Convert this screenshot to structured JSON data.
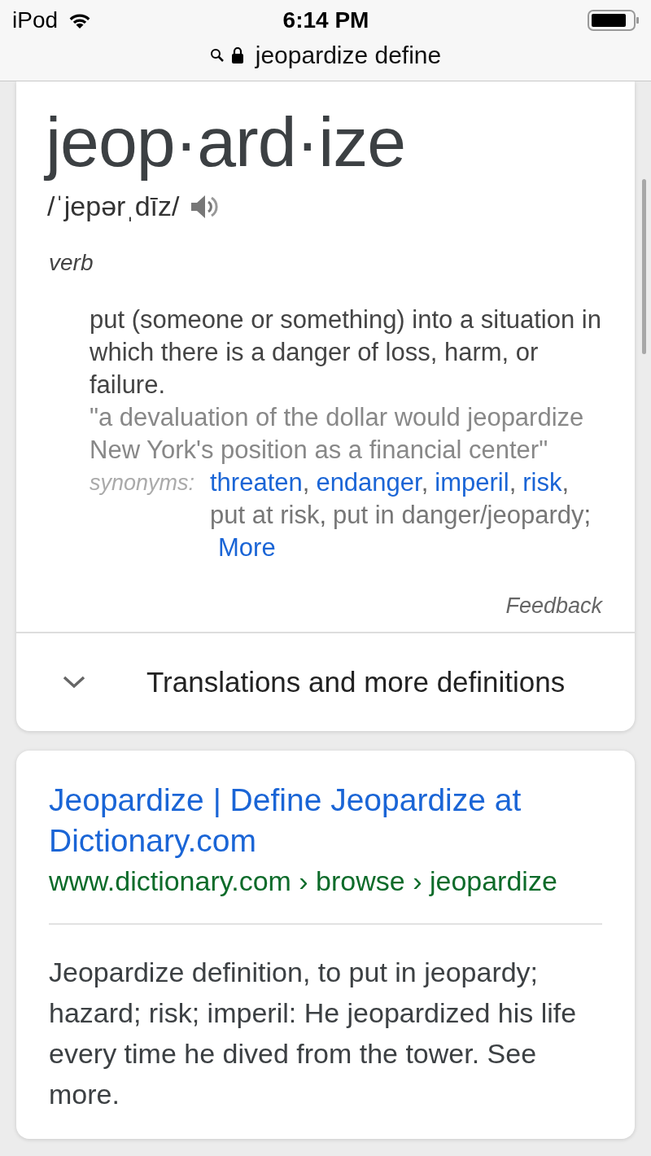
{
  "status_bar": {
    "carrier": "iPod",
    "time": "6:14 PM"
  },
  "address_bar": {
    "text": "jeopardize define"
  },
  "definition_card": {
    "headword": "jeop·ard·ize",
    "pronunciation": "/ˈjepərˌdīz/",
    "part_of_speech": "verb",
    "definition": "put (someone or something) into a situation in which there is a danger of loss, harm, or failure.",
    "example": "\"a devaluation of the dollar would jeopardize New York's position as a financial center\"",
    "synonyms_label": "synonyms:",
    "synonyms": [
      {
        "text": "threaten",
        "kind": "link",
        "sep": ","
      },
      {
        "text": "endanger",
        "kind": "link",
        "sep": ","
      },
      {
        "text": "imperil",
        "kind": "link",
        "sep": ","
      },
      {
        "text": "risk",
        "kind": "link",
        "sep": ","
      },
      {
        "text": "put at risk",
        "kind": "text",
        "sep": ","
      },
      {
        "text": "put in danger/jeopardy",
        "kind": "text",
        "sep": ";"
      }
    ],
    "more": "More",
    "feedback": "Feedback",
    "expander": {
      "label": "Translations and more definitions",
      "expanded": false
    }
  },
  "result": {
    "title": "Jeopardize | Define Jeopardize at Dictionary.com",
    "breadcrumb": "www.dictionary.com › browse › jeopardize",
    "snippet": "Jeopardize definition, to put in jeopardy; hazard; risk; imperil: He jeopardized his life every time he dived from the tower. See more."
  }
}
